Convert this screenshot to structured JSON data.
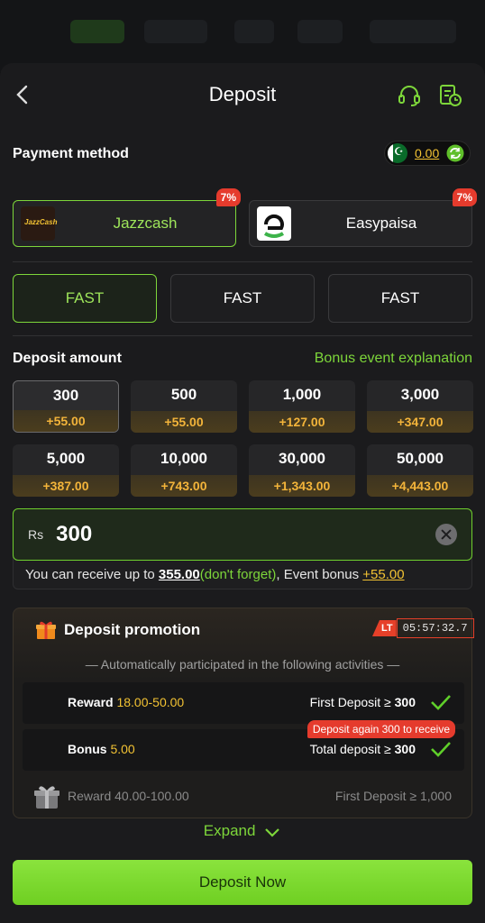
{
  "header": {
    "title": "Deposit"
  },
  "payment": {
    "label": "Payment method",
    "balance": "0.00",
    "methods": [
      {
        "name": "Jazzcash",
        "badge": "7%",
        "logo_text": "JazzCash"
      },
      {
        "name": "Easypaisa",
        "badge": "7%"
      }
    ],
    "channels": [
      "FAST",
      "FAST",
      "FAST"
    ]
  },
  "deposit": {
    "label": "Deposit amount",
    "bonus_link": "Bonus event explanation",
    "amounts": [
      {
        "value": "300",
        "bonus": "+55.00"
      },
      {
        "value": "500",
        "bonus": "+55.00"
      },
      {
        "value": "1,000",
        "bonus": "+127.00"
      },
      {
        "value": "3,000",
        "bonus": "+347.00"
      },
      {
        "value": "5,000",
        "bonus": "+387.00"
      },
      {
        "value": "10,000",
        "bonus": "+743.00"
      },
      {
        "value": "30,000",
        "bonus": "+1,343.00"
      },
      {
        "value": "50,000",
        "bonus": "+4,443.00"
      }
    ],
    "input": {
      "currency": "Rs",
      "value": "300",
      "receive_prefix": "You can receive up to ",
      "receive_amount": "355.00",
      "receive_note": "(don't forget)",
      "event_text": ", Event bonus ",
      "event_bonus": "+55.00"
    }
  },
  "promotion": {
    "title": "Deposit promotion",
    "lt_tag": "LT",
    "countdown": "05:57:32.7",
    "auto_text": "— Automatically participated in the following activities —",
    "rows": [
      {
        "left_label": "Reward ",
        "left_value": "18.00-50.00",
        "right_label": "First Deposit ≥ ",
        "right_value": "300"
      },
      {
        "left_label": "Bonus ",
        "left_value": "5.00",
        "right_label": "Total deposit ≥ ",
        "right_value": "300",
        "tip": "Deposit again 300 to receive"
      },
      {
        "left_label": "Reward ",
        "left_value": "40.00-100.00",
        "right_label": "First Deposit ≥ ",
        "right_value": "1,000"
      }
    ],
    "expand": "Expand"
  },
  "cta": {
    "label": "Deposit Now"
  },
  "colors": {
    "accent": "#7dd63a",
    "bonus": "#f3b43a",
    "badge": "#e53b2d"
  }
}
